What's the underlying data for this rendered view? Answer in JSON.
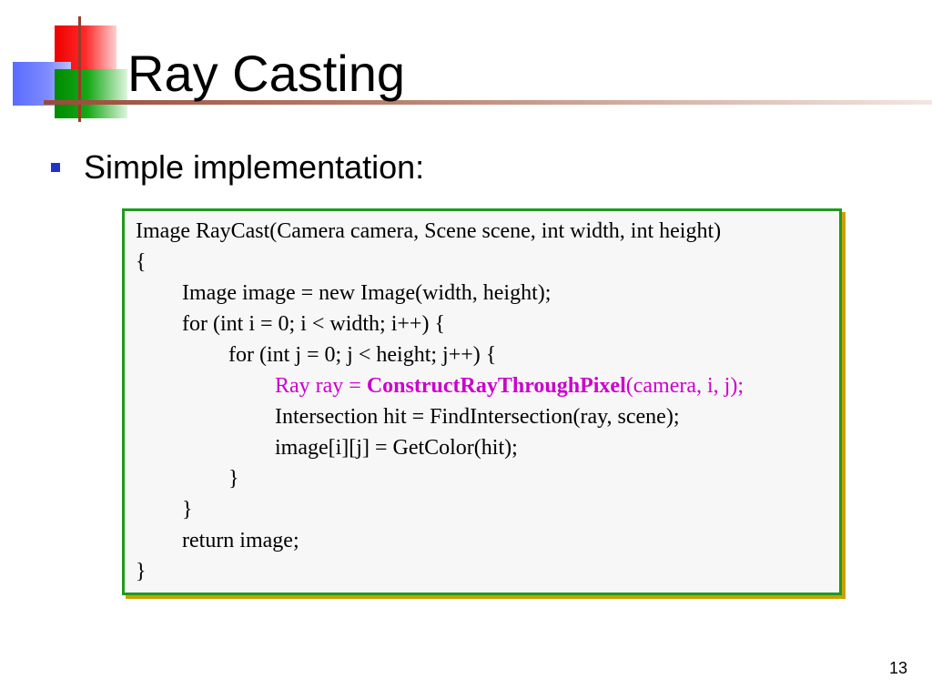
{
  "slide": {
    "title": "Ray Casting",
    "bullet": "Simple implementation:",
    "page_number": "13"
  },
  "code": {
    "lines": [
      "Image RayCast(Camera camera, Scene scene, int width, int height)",
      "{",
      "Image image = new Image(width, height);",
      "for (int i = 0; i < width; i++) {",
      "for (int j = 0; j < height; j++) {",
      "",
      "Intersection hit = FindIntersection(ray, scene);",
      "image[i][j] = GetColor(hit);",
      "}",
      "}",
      "return image;",
      "}"
    ],
    "highlight": {
      "prefix": "Ray ray = ",
      "function": "ConstructRayThroughPixel",
      "suffix": "(camera, i, j);"
    }
  },
  "colors": {
    "bullet": "#2233cc",
    "highlight": "#cc00cc",
    "code_border": "#1e9b1e",
    "code_shadow": "#c9a200"
  }
}
